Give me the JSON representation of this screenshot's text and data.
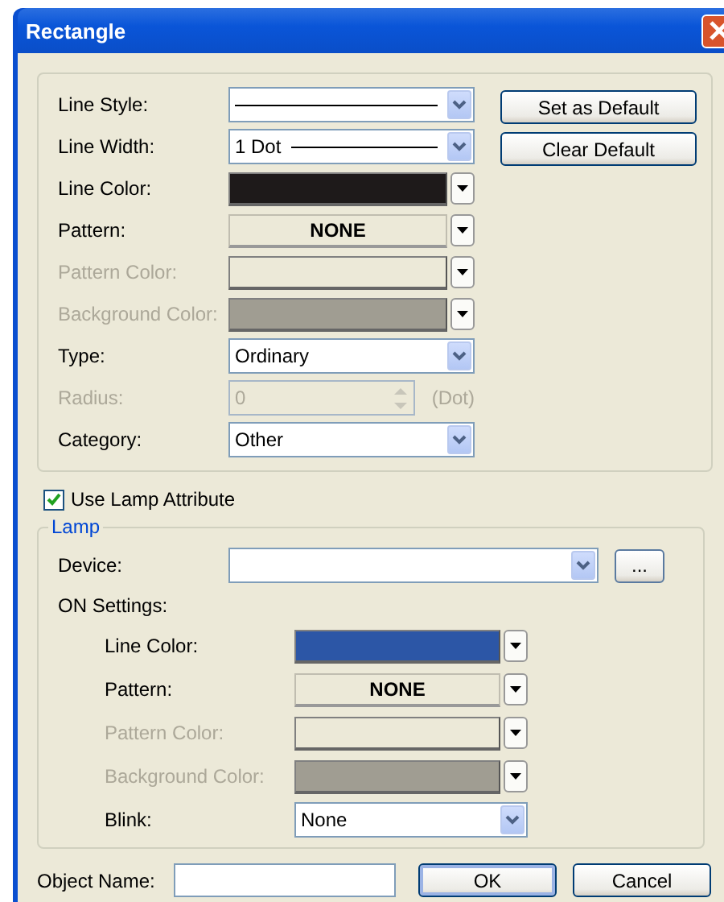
{
  "window": {
    "title": "Rectangle"
  },
  "properties": [
    {
      "kind": "line",
      "label": "Line Style:",
      "disabled": false
    },
    {
      "kind": "line",
      "label": "Line Width:",
      "value": "1 Dot",
      "disabled": false
    },
    {
      "kind": "color",
      "label": "Line Color:",
      "color": "#1e1a1a",
      "disabled": false
    },
    {
      "kind": "pattern",
      "label": "Pattern:",
      "value": "NONE",
      "disabled": false
    },
    {
      "kind": "color",
      "label": "Pattern Color:",
      "color": "#ece9d8",
      "disabled": true
    },
    {
      "kind": "color",
      "label": "Background Color:",
      "color": "#a09d92",
      "disabled": true
    },
    {
      "kind": "combo",
      "label": "Type:",
      "value": "Ordinary",
      "disabled": false
    },
    {
      "kind": "spin",
      "label": "Radius:",
      "value": "0",
      "unit": "(Dot)",
      "disabled": true
    },
    {
      "kind": "combo",
      "label": "Category:",
      "value": "Other",
      "disabled": false
    }
  ],
  "default_buttons": [
    "Set as Default",
    "Clear Default"
  ],
  "use_lamp": {
    "label": "Use Lamp Attribute",
    "checked": true
  },
  "lamp": {
    "title": "Lamp",
    "device_label": "Device:",
    "browse_button": "...",
    "on_settings_label": "ON Settings:",
    "on_settings": [
      {
        "kind": "color",
        "label": "Line Color:",
        "color": "#2c56a6",
        "disabled": false
      },
      {
        "kind": "pattern",
        "label": "Pattern:",
        "value": "NONE",
        "disabled": false
      },
      {
        "kind": "color",
        "label": "Pattern Color:",
        "color": "#ece9d8",
        "disabled": true
      },
      {
        "kind": "color",
        "label": "Background Color:",
        "color": "#a09d92",
        "disabled": true
      },
      {
        "kind": "combo",
        "label": "Blink:",
        "value": "None",
        "disabled": false
      }
    ]
  },
  "object_name": {
    "label": "Object Name:"
  },
  "buttons": [
    "OK",
    "Cancel"
  ]
}
